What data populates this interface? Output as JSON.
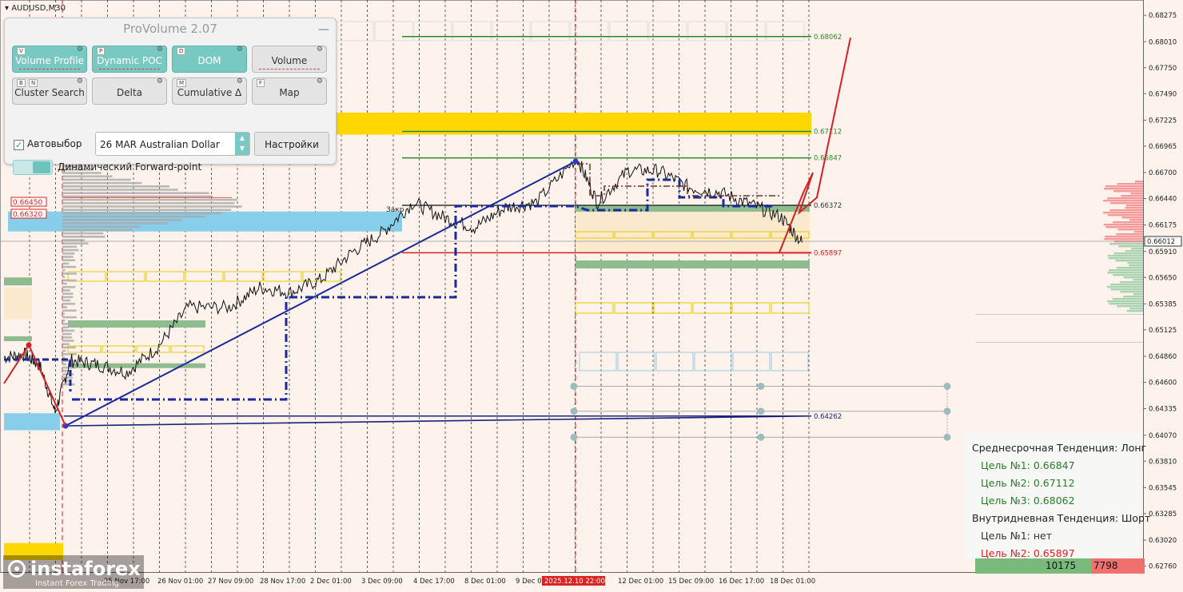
{
  "symbol": "AUDUSD,M30",
  "panel": {
    "title": "ProVolume 2.07",
    "minimize_icon": "minus-icon",
    "buttons": [
      {
        "label": "Volume Profile",
        "key": "V",
        "active": true
      },
      {
        "label": "Dynamic POC",
        "key": "P",
        "active": true
      },
      {
        "label": "DOM",
        "key": "D",
        "active": true
      },
      {
        "label": "Volume",
        "key": "",
        "active": false
      },
      {
        "label": "Cluster Search",
        "key": "B",
        "key2": "N",
        "active": false
      },
      {
        "label": "Delta",
        "key": "",
        "active": false
      },
      {
        "label": "Cumulative Δ",
        "key": "M",
        "active": false
      },
      {
        "label": "Map",
        "key": "F",
        "active": false
      }
    ],
    "autoselect_label": "Автовыбор",
    "autoselect_checked": true,
    "contract_value": "26 MAR Australian Dollar",
    "settings_label": "Настройки",
    "forward_point_label": "Динамический Forward-point"
  },
  "price_tags": {
    "left_1": "0.66450",
    "left_2": "0.66320",
    "current": "0.66012",
    "zakr": "Закр"
  },
  "levels": [
    {
      "label": "0.68062",
      "price": 0.68062,
      "color": "#2a8a2a"
    },
    {
      "label": "0.67112",
      "price": 0.67112,
      "color": "#2a8a2a"
    },
    {
      "label": "0.66847",
      "price": 0.66847,
      "color": "#2a8a2a"
    },
    {
      "label": "0.66372",
      "price": 0.66372,
      "color": "#333333"
    },
    {
      "label": "0.65897",
      "price": 0.65897,
      "color": "#d22222"
    },
    {
      "label": "0.64262",
      "price": 0.64262,
      "color": "#1a237e"
    }
  ],
  "info_box": {
    "mid_title": "Среднесрочная Тенденция: Лонг",
    "mid_t1": "Цель №1: 0.66847",
    "mid_t2": "Цель №2: 0.67112",
    "mid_t3": "Цель №3: 0.68062",
    "intra_title": "Внутридневная Тенденция: Шорт",
    "intra_t1": "Цель №1: нет",
    "intra_t2": "Цель №2: 0.65897"
  },
  "volume_bar": {
    "buy": "10175",
    "sell": "7798"
  },
  "logo": {
    "name": "instaforex",
    "tagline": "Instant Forex Trading"
  },
  "colors": {
    "background": "#fdf3ec",
    "accent": "#79c9c3",
    "trend_red": "#d22222",
    "trend_blue": "#1a2a9a",
    "zone_yellow": "#ffd700",
    "zone_blue": "#87ceeb",
    "zone_green": "#8fbc8f"
  },
  "chart_data": {
    "type": "line",
    "ylim": [
      0.627,
      0.6838
    ],
    "y_ticks": [
      "0.68275",
      "0.68010",
      "0.67750",
      "0.67490",
      "0.67225",
      "0.66965",
      "0.66700",
      "0.66440",
      "0.66175",
      "0.65910",
      "0.65650",
      "0.65385",
      "0.65125",
      "0.64860",
      "0.64600",
      "0.64335",
      "0.64070",
      "0.63810",
      "0.63545",
      "0.63285",
      "0.63020",
      "0.62760"
    ],
    "x_ticks": [
      "25 Nov 17:00",
      "26 Nov 01:00",
      "27 Nov 09:00",
      "28 Nov 17:00",
      "2 Dec 01:00",
      "3 Dec 09:00",
      "4 Dec 17:00",
      "8 Dec 01:00",
      "9 Dec 09:00",
      "2025.12.10 22:00",
      "12 Dec 01:00",
      "15 Dec 09:00",
      "16 Dec 17:00",
      "18 Dec 01:00"
    ],
    "price_path": [
      {
        "t": 0,
        "p": 0.6485
      },
      {
        "t": 0.02,
        "p": 0.6488
      },
      {
        "t": 0.035,
        "p": 0.6477
      },
      {
        "t": 0.05,
        "p": 0.643
      },
      {
        "t": 0.065,
        "p": 0.6482
      },
      {
        "t": 0.09,
        "p": 0.6478
      },
      {
        "t": 0.12,
        "p": 0.647
      },
      {
        "t": 0.15,
        "p": 0.6495
      },
      {
        "t": 0.18,
        "p": 0.6535
      },
      {
        "t": 0.22,
        "p": 0.6535
      },
      {
        "t": 0.25,
        "p": 0.6555
      },
      {
        "t": 0.28,
        "p": 0.655
      },
      {
        "t": 0.31,
        "p": 0.6563
      },
      {
        "t": 0.34,
        "p": 0.659
      },
      {
        "t": 0.37,
        "p": 0.661
      },
      {
        "t": 0.4,
        "p": 0.664
      },
      {
        "t": 0.43,
        "p": 0.6625
      },
      {
        "t": 0.46,
        "p": 0.6615
      },
      {
        "t": 0.49,
        "p": 0.6635
      },
      {
        "t": 0.52,
        "p": 0.664
      },
      {
        "t": 0.56,
        "p": 0.6685
      },
      {
        "t": 0.58,
        "p": 0.664
      },
      {
        "t": 0.61,
        "p": 0.6672
      },
      {
        "t": 0.64,
        "p": 0.6672
      },
      {
        "t": 0.67,
        "p": 0.6655
      },
      {
        "t": 0.7,
        "p": 0.665
      },
      {
        "t": 0.73,
        "p": 0.6638
      },
      {
        "t": 0.76,
        "p": 0.6625
      },
      {
        "t": 0.78,
        "p": 0.66
      }
    ],
    "forecast": [
      0.659,
      0.665,
      0.667,
      0.663,
      0.6645,
      0.6805
    ]
  }
}
